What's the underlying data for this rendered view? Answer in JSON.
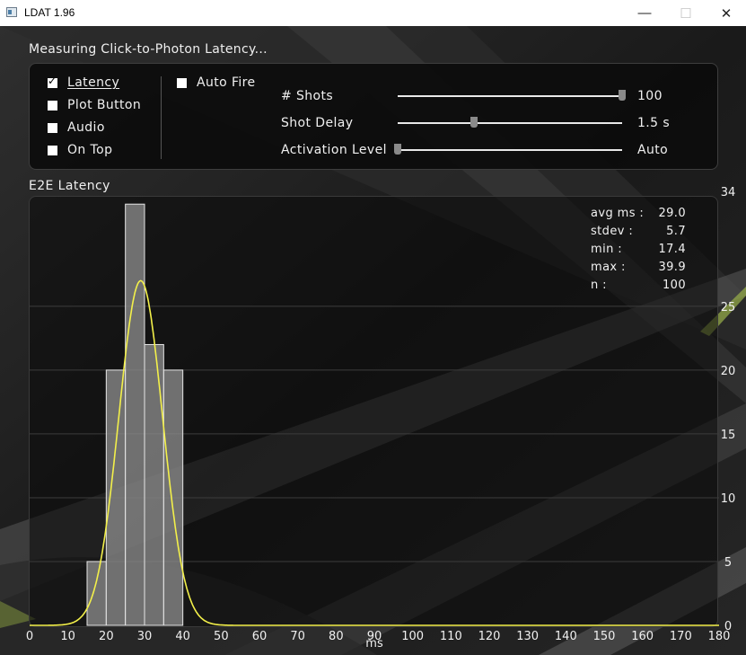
{
  "window": {
    "title": "LDAT 1.96",
    "minimize_glyph": "—",
    "maximize_glyph": "☐",
    "close_glyph": "✕"
  },
  "status": "Measuring  Click-to-Photon  Latency...",
  "checkboxes": [
    {
      "label": "Latency",
      "checked": true
    },
    {
      "label": "Plot  Button",
      "checked": false
    },
    {
      "label": "Audio",
      "checked": false
    },
    {
      "label": "On  Top",
      "checked": false
    }
  ],
  "auto_fire": {
    "label": "Auto  Fire",
    "checked": false
  },
  "sliders": [
    {
      "label": "#  Shots",
      "value_text": "100",
      "level": 1.0
    },
    {
      "label": "Shot  Delay",
      "value_text": "1.5  s",
      "level": 0.34
    },
    {
      "label": "Activation  Level",
      "value_text": "Auto",
      "level": 0.0
    }
  ],
  "plot_title": "E2E  Latency",
  "stats": [
    {
      "label": "avg  ms  :",
      "value": "29.0"
    },
    {
      "label": "stdev  :",
      "value": "5.7"
    },
    {
      "label": "min  :",
      "value": "17.4"
    },
    {
      "label": "max  :",
      "value": "39.9"
    },
    {
      "label": "n  :",
      "value": "100"
    }
  ],
  "chart_data": {
    "type": "bar",
    "xlabel": "ms",
    "ylabel": "",
    "xlim": [
      0,
      180
    ],
    "ylim": [
      0,
      34
    ],
    "x_ticks": [
      0,
      10,
      20,
      30,
      40,
      50,
      60,
      70,
      80,
      90,
      100,
      110,
      120,
      130,
      140,
      150,
      160,
      170,
      180
    ],
    "y_ticks": [
      0,
      5,
      10,
      15,
      20,
      25,
      34
    ],
    "bins": [
      {
        "start": 15,
        "end": 20,
        "count": 5
      },
      {
        "start": 20,
        "end": 25,
        "count": 20
      },
      {
        "start": 25,
        "end": 30,
        "count": 33
      },
      {
        "start": 30,
        "end": 35,
        "count": 22
      },
      {
        "start": 35,
        "end": 40,
        "count": 20
      }
    ],
    "fit_curve": {
      "type": "gaussian",
      "mean": 29.0,
      "stdev": 5.7,
      "peak": 27
    },
    "colors": {
      "bars": "#8a8a8a",
      "bar_edge": "#e6e6e6",
      "curve": "#f3f04a",
      "grid": "#3c3c3c"
    },
    "grid": true
  }
}
